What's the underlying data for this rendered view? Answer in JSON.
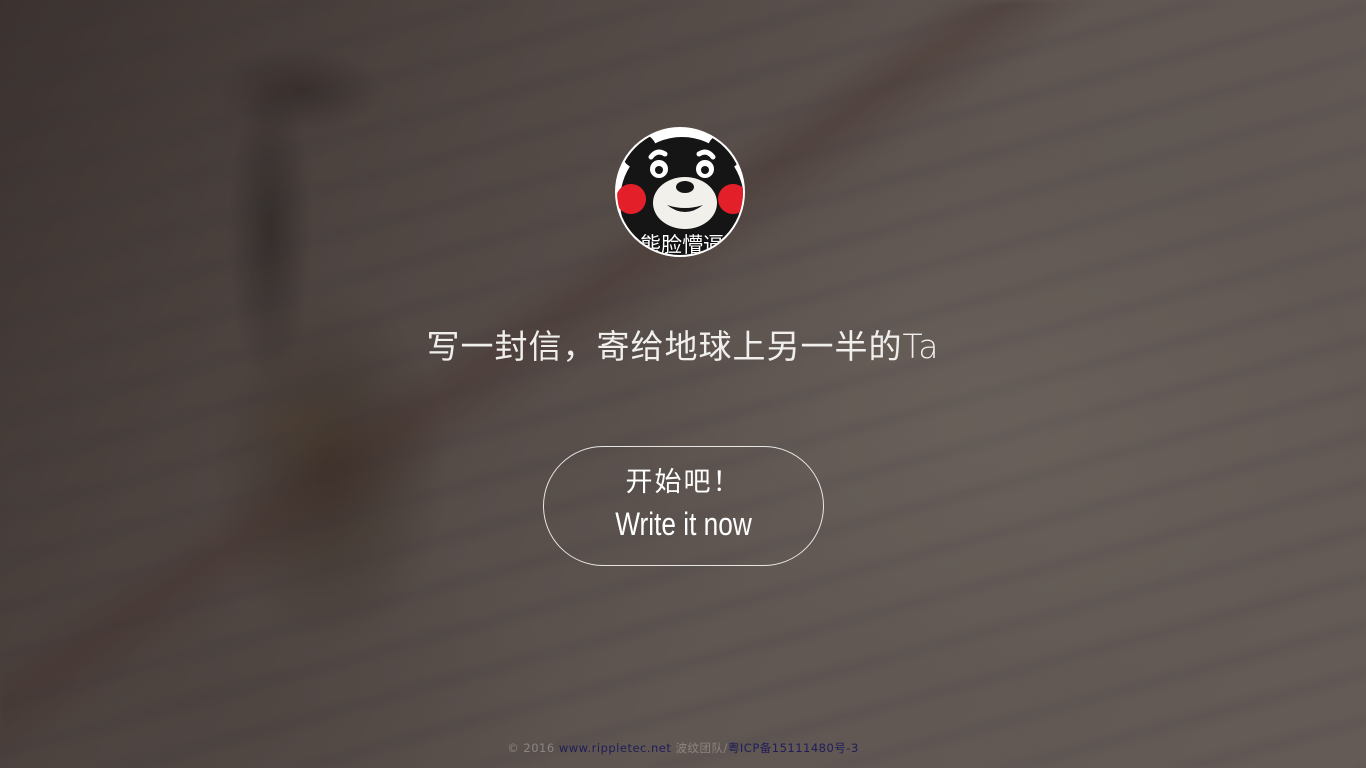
{
  "avatar": {
    "caption": "熊脸懵逼"
  },
  "tagline": "写一封信，寄给地球上另一半的Ta",
  "start_button": {
    "label_cn": "开始吧！",
    "label_en": "Write it now"
  },
  "footer": {
    "copyright": "© 2016",
    "site_link": "www.rippletec.net",
    "team": "波纹团队/",
    "icp_link": "粤ICP备15111480号-3"
  },
  "colors": {
    "link": "#1f1d5a",
    "text": "#ffffff"
  }
}
